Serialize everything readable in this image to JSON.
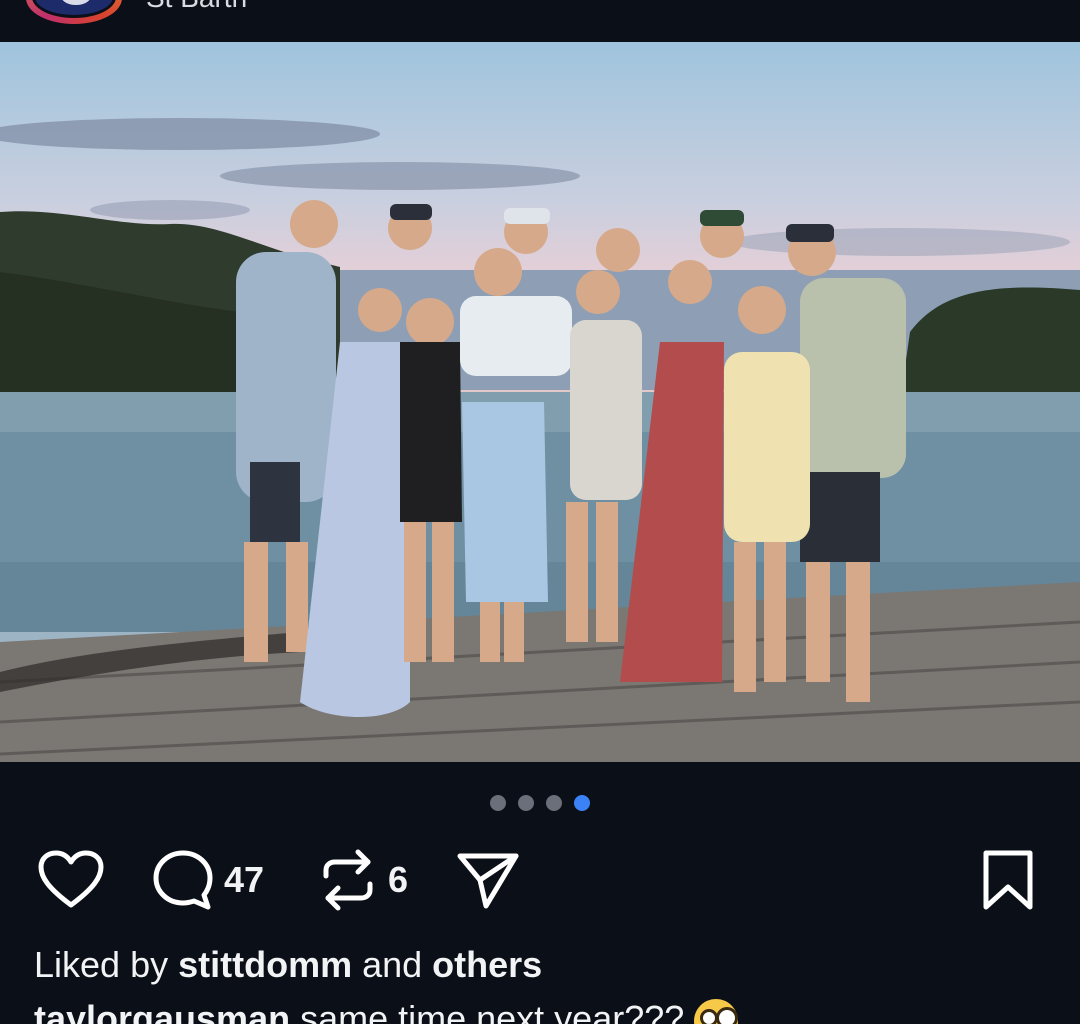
{
  "header": {
    "location": "St Barth"
  },
  "photo": {
    "description_icon": "group-photo",
    "carousel": {
      "total": 4,
      "active_index": 4
    }
  },
  "actions": {
    "like_icon": "heart-icon",
    "comment_icon": "comment-icon",
    "comment_count": "47",
    "repost_icon": "repost-icon",
    "repost_count": "6",
    "share_icon": "send-icon",
    "save_icon": "bookmark-icon"
  },
  "likes": {
    "prefix": "Liked by ",
    "user": "stittdomm",
    "middle": " and ",
    "others": "others"
  },
  "caption": {
    "user": "taylorgausman",
    "text": " same time next year???"
  },
  "colors": {
    "background": "#0b0f17",
    "active_dot": "#3b82f6",
    "inactive_dot": "#6b6f7a"
  }
}
